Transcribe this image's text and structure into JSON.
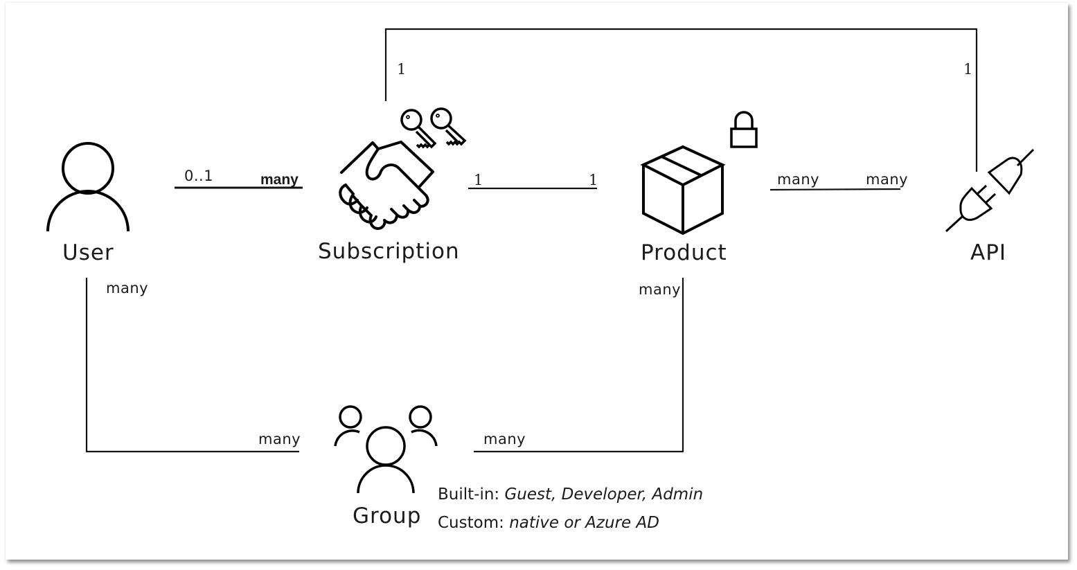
{
  "diagram": {
    "entities": {
      "user": {
        "label": "User",
        "icon": "person-icon"
      },
      "subscription": {
        "label": "Subscription",
        "icon": "handshake-icon",
        "badge_icon": "keys-icon"
      },
      "product": {
        "label": "Product",
        "icon": "box-icon",
        "badge_icon": "padlock-icon"
      },
      "api": {
        "label": "API",
        "icon": "plug-icon"
      },
      "group": {
        "label": "Group",
        "icon": "group-icon"
      }
    },
    "relationships": [
      {
        "from": "user",
        "to": "subscription",
        "from_card": "0..1",
        "to_card": "many"
      },
      {
        "from": "subscription",
        "to": "product",
        "from_card": "1",
        "to_card": "1"
      },
      {
        "from": "product",
        "to": "api",
        "from_card": "many",
        "to_card": "many"
      },
      {
        "from": "subscription",
        "to": "api",
        "from_card": "1",
        "to_card": "1"
      },
      {
        "from": "user",
        "to": "group",
        "from_card": "many",
        "to_card": "many"
      },
      {
        "from": "product",
        "to": "group",
        "from_card": "many",
        "to_card": "many"
      }
    ],
    "group_note": {
      "builtin_label": "Built-in:",
      "builtin_values": "Guest, Developer, Admin",
      "custom_label": "Custom:",
      "custom_values": "native or Azure AD"
    }
  }
}
